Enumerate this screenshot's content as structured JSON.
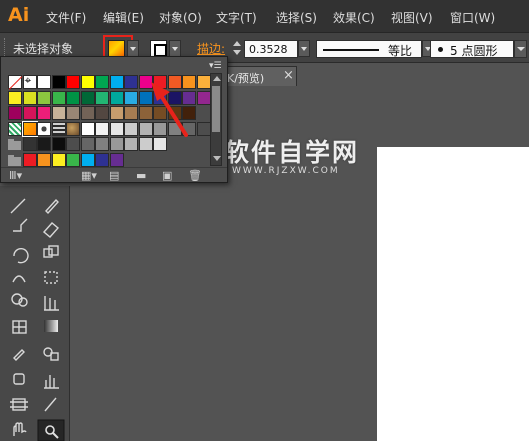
{
  "app": {
    "logo": "Ai"
  },
  "menu": [
    {
      "label": "文件(F)"
    },
    {
      "label": "编辑(E)"
    },
    {
      "label": "对象(O)"
    },
    {
      "label": "文字(T)"
    },
    {
      "label": "选择(S)"
    },
    {
      "label": "效果(C)"
    },
    {
      "label": "视图(V)"
    },
    {
      "label": "窗口(W)"
    }
  ],
  "control_bar": {
    "selection_label": "未选择对象",
    "stroke_label": "描边:",
    "stroke_weight": "0.3528",
    "profile_label": "等比",
    "brush_label": "5 点圆形"
  },
  "document_tab": {
    "title": "K/预览)",
    "close": "×"
  },
  "watermark": {
    "main": "软件自学网",
    "sub": "WWW.RJZXW.COM"
  },
  "swatches": {
    "menu_icon": "panel-menu-icon",
    "rows": [
      [
        "none",
        "registration",
        "#ffffff",
        "#000000",
        "#ff0000",
        "#ffff00",
        "#00a651",
        "#00aeef",
        "#2e3192",
        "#ec008c",
        "#ed1c24",
        "#f15a24",
        "#f7931e",
        "#fbb03b"
      ],
      [
        "#fcee21",
        "#d9e021",
        "#8cc63f",
        "#39b54a",
        "#009245",
        "#006837",
        "#22b573",
        "#00a99d",
        "#29abe2",
        "#0071bc",
        "#2e3192",
        "#1b1464",
        "#662d91",
        "#93278f"
      ],
      [
        "#9e005d",
        "#d4145a",
        "#ed1e79",
        "#c7b299",
        "#998675",
        "#736357",
        "#534741",
        "#c69c6d",
        "#a67c52",
        "#8c6239",
        "#754c24",
        "#603813",
        "#42210b"
      ],
      [
        "pattern",
        "gradient",
        "pattern2",
        "pattern3",
        "pattern4",
        "#ffffff",
        "#f2f2f2",
        "#e6e6e6",
        "#cccccc",
        "#b3b3b3",
        "#999999",
        "#808080",
        "#666666",
        "#4d4d4d"
      ],
      [
        "folder",
        "#333333",
        "#1a1a1a",
        "#0d0d0d",
        "#4d4d4d",
        "#666666",
        "#808080",
        "#999999",
        "#b3b3b3",
        "#cccccc",
        "#e6e6e6"
      ],
      [
        "folder",
        "#ed1c24",
        "#f7931e",
        "#fcee21",
        "#39b54a",
        "#00aeef",
        "#2e3192",
        "#662d91"
      ]
    ]
  },
  "panel_footer": [
    "library-icon",
    "show-kinds-icon",
    "swatch-options-icon",
    "new-color-group-icon",
    "new-swatch-icon",
    "delete-swatch-icon"
  ],
  "colors": {
    "accent": "#f7931e",
    "annotation": "#e8231b"
  }
}
